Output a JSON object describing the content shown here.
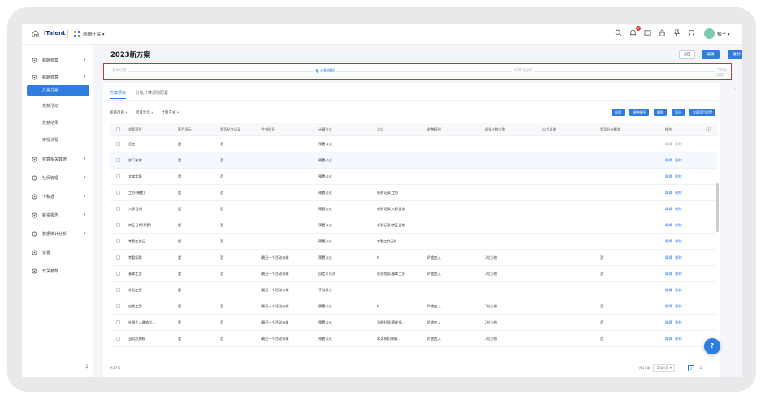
{
  "header": {
    "brand": "iTalent",
    "module": "薪酬社保 ▾",
    "notification_count": "9",
    "user_name": "橘子 ▾"
  },
  "sidebar": {
    "items": [
      {
        "label": "薪酬档案",
        "chevron": "▾"
      },
      {
        "label": "薪酬核算",
        "chevron": "▾"
      },
      {
        "label": "核算相关数据",
        "chevron": "▾"
      },
      {
        "label": "社保管理",
        "chevron": "▾"
      },
      {
        "label": "个税通",
        "chevron": "▾"
      },
      {
        "label": "薪资报告",
        "chevron": "▾"
      },
      {
        "label": "数据统计分析",
        "chevron": "▾"
      },
      {
        "label": "设置",
        "chevron": ""
      },
      {
        "label": "开关参数",
        "chevron": ""
      }
    ],
    "subitems": [
      "方案方案",
      "发薪活动",
      "发薪结果",
      "审批流程"
    ]
  },
  "page": {
    "title": "2023新方案",
    "back_label": "返回",
    "edit_label": "编辑",
    "copy_label": "复制"
  },
  "steps": [
    "基本信息",
    "计算规则",
    "核算与分析",
    "工资条设置"
  ],
  "side_mark": "‹",
  "tabs": [
    "方案项目",
    "分批计算规则配置"
  ],
  "filters": [
    "发薪项目",
    "项目显示",
    "计算方式"
  ],
  "actions": [
    "新增",
    "调整顺序",
    "删除",
    "导出",
    "发薪项目设置"
  ],
  "table": {
    "columns": [
      "发薪项目",
      "项目显示",
      "是否允许记录",
      "生效阶段",
      "计算方式",
      "公式",
      "取整规则",
      "保留小数位数",
      "公式说明",
      "是否允许覆盖",
      "操作"
    ],
    "rows": [
      {
        "item": "员工",
        "show": "是",
        "allow": "否",
        "stage": "",
        "method": "预置公式",
        "formula": "",
        "rounding": "",
        "decimals": "",
        "note": "",
        "override": "",
        "op1": "编辑",
        "op2": "删除",
        "muted": true
      },
      {
        "item": "部门名称",
        "show": "是",
        "allow": "否",
        "stage": "",
        "method": "预置公式",
        "formula": "",
        "rounding": "",
        "decimals": "",
        "note": "",
        "override": "",
        "op1": "编辑",
        "op2": "删除",
        "muted": false
      },
      {
        "item": "文本字段",
        "show": "是",
        "allow": "否",
        "stage": "",
        "method": "预置公式",
        "formula": "",
        "rounding": "",
        "decimals": "",
        "note": "",
        "override": "",
        "op1": "编辑",
        "op2": "删除",
        "muted": false
      },
      {
        "item": "工号(預置)",
        "show": "是",
        "allow": "否",
        "stage": "",
        "method": "预置公式",
        "formula": "任职记录.工号",
        "rounding": "",
        "decimals": "",
        "note": "",
        "override": "",
        "op1": "编辑",
        "op2": "删除",
        "muted": false
      },
      {
        "item": "入职日期",
        "show": "是",
        "allow": "否",
        "stage": "",
        "method": "预置公式",
        "formula": "任职记录.入职日期",
        "rounding": "",
        "decimals": "",
        "note": "",
        "override": "",
        "op1": "编辑",
        "op2": "删除",
        "muted": false
      },
      {
        "item": "转正日期(預置)",
        "show": "是",
        "allow": "否",
        "stage": "",
        "method": "预置公式",
        "formula": "任职记录.转正日期",
        "rounding": "",
        "decimals": "",
        "note": "",
        "override": "",
        "op1": "编辑",
        "op2": "删除",
        "muted": false
      },
      {
        "item": "考勤工作日",
        "show": "是",
        "allow": "否",
        "stage": "",
        "method": "预置公式",
        "formula": "考勤工作日()",
        "rounding": "",
        "decimals": "",
        "note": "",
        "override": "",
        "op1": "编辑",
        "op2": "删除",
        "muted": false
      },
      {
        "item": "考勤扣款",
        "show": "是",
        "allow": "否",
        "stage": "最后一个活动有效",
        "method": "预置公式",
        "formula": "0",
        "rounding": "四舍五入",
        "decimals": "2位小数",
        "note": "",
        "override": "否",
        "op1": "编辑",
        "op2": "删除",
        "muted": false
      },
      {
        "item": "基本工资",
        "show": "是",
        "allow": "否",
        "stage": "最后一个活动有效",
        "method": "自定义公式",
        "formula": "薪资档案.基本工资",
        "rounding": "四舍五入",
        "decimals": "2位小数",
        "note": "",
        "override": "否",
        "op1": "编辑",
        "op2": "删除",
        "muted": false
      },
      {
        "item": "补贴工资",
        "show": "是",
        "allow": "",
        "stage": "最后一个活动有效",
        "method": "手动录入",
        "formula": "",
        "rounding": "",
        "decimals": "",
        "note": "",
        "override": "",
        "op1": "编辑",
        "op2": "删除",
        "muted": false
      },
      {
        "item": "应发工资",
        "show": "是",
        "allow": "否",
        "stage": "最后一个活动有效",
        "method": "预置公式",
        "formula": "0",
        "rounding": "四舍五入",
        "decimals": "2位小数",
        "note": "",
        "override": "否",
        "op1": "编辑",
        "op2": "删除",
        "muted": false
      },
      {
        "item": "社保个人缴纳比...",
        "show": "是",
        "allow": "否",
        "stage": "最后一个活动有效",
        "method": "预置公式",
        "formula": "当期社保.养老保...",
        "rounding": "四舍五入",
        "decimals": "2位小数",
        "note": "",
        "override": "否",
        "op1": "编辑",
        "op2": "删除",
        "muted": false
      },
      {
        "item": "当月应纳税",
        "show": "是",
        "allow": "否",
        "stage": "最后一个活动有效",
        "method": "预置公式",
        "formula": "本月预扣预缴...",
        "rounding": "四舍五入",
        "decimals": "2位小数",
        "note": "",
        "override": "否",
        "op1": "编辑",
        "op2": "删除",
        "muted": false
      }
    ]
  },
  "pager": {
    "total": "共17条",
    "total_right": "共17条",
    "page_size": "50条/页 ▾",
    "prev": "‹",
    "pages": [
      "1",
      "2"
    ],
    "next": "›"
  },
  "help": "?"
}
